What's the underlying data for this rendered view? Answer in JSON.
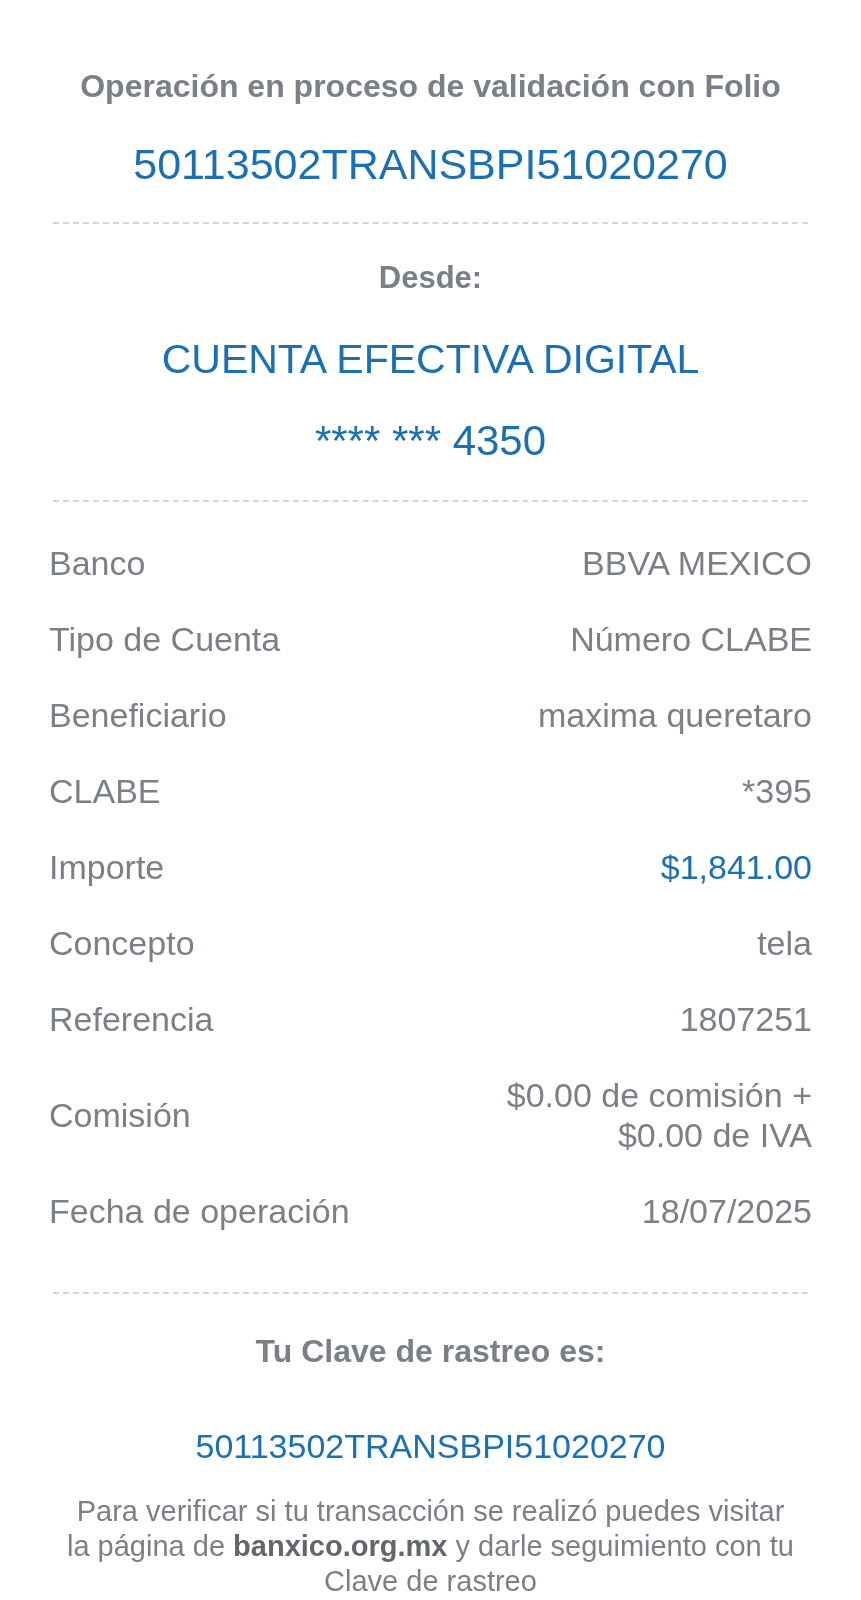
{
  "header": {
    "title": "Operación en proceso de validación con Folio",
    "folio": "50113502TRANSBPI51020270"
  },
  "origin": {
    "label": "Desde:",
    "account_name": "CUENTA EFECTIVA DIGITAL",
    "account_number": "**** *** 4350"
  },
  "details": [
    {
      "label": "Banco",
      "value": "BBVA MEXICO",
      "kind": "plain"
    },
    {
      "label": "Tipo de Cuenta",
      "value": "Número CLABE",
      "kind": "plain"
    },
    {
      "label": "Beneficiario",
      "value": "maxima queretaro",
      "kind": "plain"
    },
    {
      "label": "CLABE",
      "value": "*395",
      "kind": "plain"
    },
    {
      "label": "Importe",
      "value": "$1,841.00",
      "kind": "amount"
    },
    {
      "label": "Concepto",
      "value": "tela",
      "kind": "plain"
    },
    {
      "label": "Referencia",
      "value": "1807251",
      "kind": "plain"
    },
    {
      "label": "Comisión",
      "value": "$0.00 de comisión + $0.00 de IVA",
      "kind": "plain"
    },
    {
      "label": "Fecha de operación",
      "value": "18/07/2025",
      "kind": "plain"
    }
  ],
  "tracking": {
    "label": "Tu Clave de rastreo es:",
    "code": "50113502TRANSBPI51020270",
    "note": "Para verificar si tu transacción se realizó puedes visitar la página de **banxico.org.mx** y darle seguimiento con tu Clave de rastreo"
  }
}
